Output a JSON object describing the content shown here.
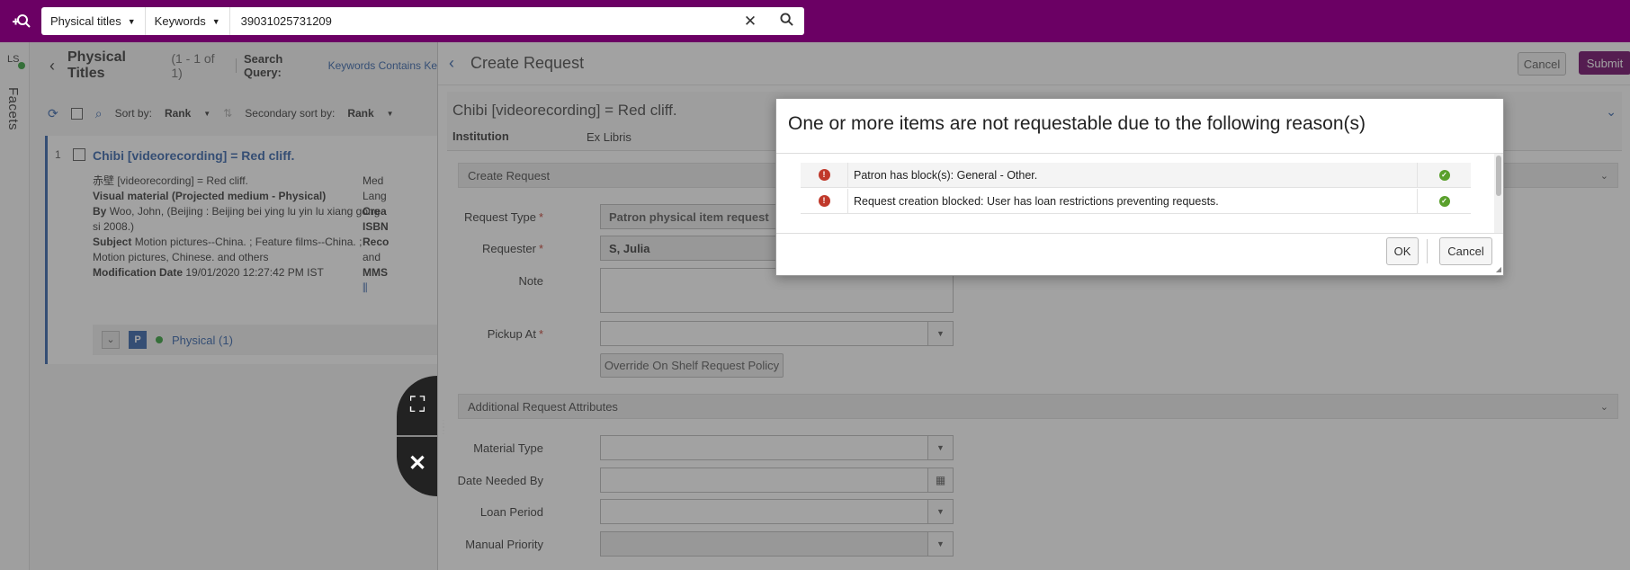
{
  "topbar": {
    "search_type": "Physical titles",
    "search_field": "Keywords",
    "search_value": "39031025731209"
  },
  "facets": {
    "label": "Facets",
    "ls": "LS"
  },
  "results": {
    "title": "Physical Titles",
    "count": "(1 - 1 of 1)",
    "search_query_label": "Search Query:",
    "search_query_value": "Keywords Contains Ke",
    "sort_label": "Sort by:",
    "sort_value": "Rank",
    "secondary_sort_label": "Secondary sort by:",
    "secondary_sort_value": "Rank",
    "item": {
      "number": "1",
      "title": "Chibi [videorecording] = Red cliff.",
      "alt_title": "赤壁 [videorecording] = Red cliff.",
      "material": "Visual material (Projected medium - Physical)",
      "by_label": "By",
      "by_value": "Woo, John, (Beijing : Beijing bei ying lu yin lu xiang gong si 2008.)",
      "subject_label": "Subject",
      "subject_value": "Motion pictures--China. ; Feature films--China. ; Motion pictures, Chinese. and others",
      "mod_label": "Modification Date",
      "mod_value": "19/01/2020 12:27:42 PM IST",
      "col2": [
        "Med",
        "Lang",
        "Crea",
        "ISBN",
        "Reco",
        "and",
        "MMS"
      ],
      "holding_badge": "P",
      "holding_label": "Physical (1)"
    }
  },
  "create_request": {
    "title": "Create Request",
    "cancel_label": "Cancel",
    "submit_label": "Submit",
    "record_title": "Chibi [videorecording] = Red cliff.",
    "institution_label": "Institution",
    "institution_value": "Ex Libris",
    "section_create": "Create Request",
    "section_additional": "Additional Request Attributes",
    "fields": {
      "request_type_label": "Request Type",
      "request_type_value": "Patron physical item request",
      "requester_label": "Requester",
      "requester_value": "S, Julia",
      "note_label": "Note",
      "pickup_label": "Pickup At",
      "override_label": "Override On Shelf Request Policy",
      "material_type_label": "Material Type",
      "date_needed_label": "Date Needed By",
      "loan_period_label": "Loan Period",
      "manual_priority_label": "Manual Priority"
    }
  },
  "dialog": {
    "title": "One or more items are not requestable due to the following reason(s)",
    "reasons": [
      "Patron has block(s): General - Other.",
      "Request creation blocked: User has loan restrictions preventing requests."
    ],
    "ok_label": "OK",
    "cancel_label": "Cancel"
  },
  "colors": {
    "brand": "#6b0064",
    "link": "#2e5fa8",
    "error": "#c0392b",
    "success": "#5aa02c"
  }
}
